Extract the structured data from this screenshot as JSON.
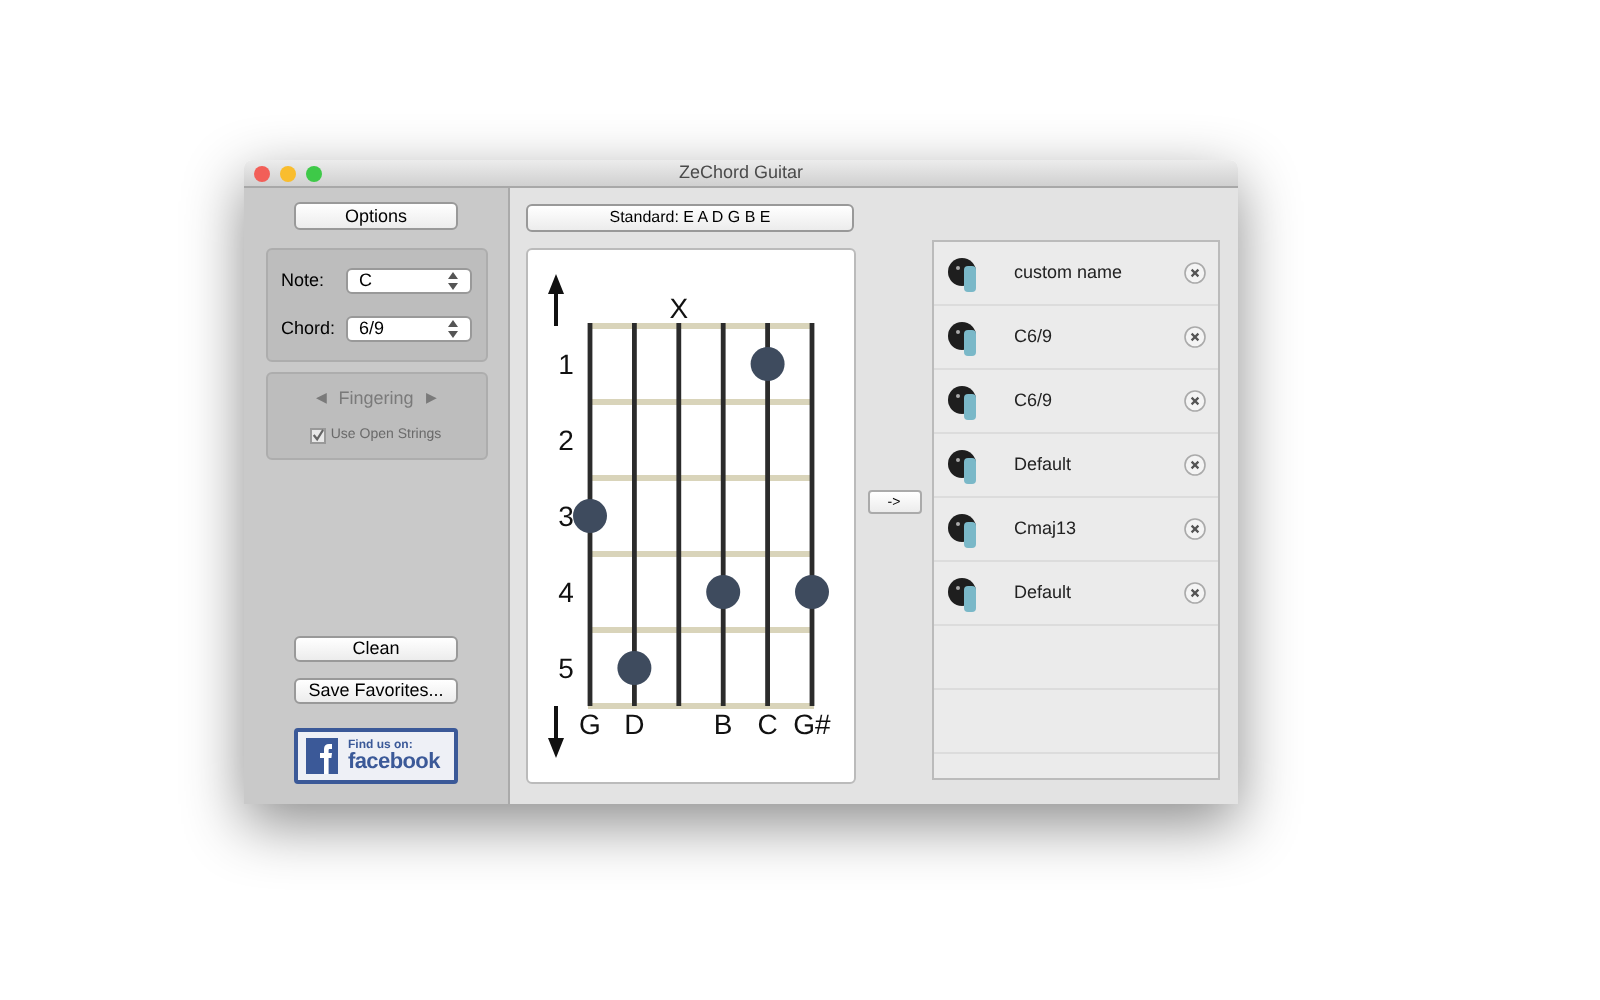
{
  "window": {
    "title": "ZeChord Guitar"
  },
  "sidebar": {
    "options_button": "Options",
    "note": {
      "label": "Note:",
      "value": "C"
    },
    "chord": {
      "label": "Chord:",
      "value": "6/9"
    },
    "fingering": {
      "prev": "◀",
      "label": "Fingering",
      "next": "▶",
      "disabled": true
    },
    "use_open_strings": {
      "label": "Use Open Strings",
      "checked": true,
      "disabled": true
    },
    "clean_button": "Clean",
    "save_button": "Save Favorites...",
    "facebook": {
      "line1": "Find us on:",
      "line2": "facebook"
    }
  },
  "tuning_button": "Standard: E A D G B E",
  "diagram": {
    "frets": [
      {
        "label": "1",
        "pressed": [
          false,
          false,
          false,
          false,
          true,
          false
        ]
      },
      {
        "label": "2",
        "pressed": [
          false,
          false,
          false,
          false,
          false,
          false
        ]
      },
      {
        "label": "3",
        "pressed": [
          true,
          false,
          false,
          false,
          false,
          false
        ]
      },
      {
        "label": "4",
        "pressed": [
          false,
          false,
          false,
          true,
          false,
          true
        ]
      },
      {
        "label": "5",
        "pressed": [
          false,
          true,
          false,
          false,
          false,
          false
        ]
      }
    ],
    "muted_mark": "X",
    "strings": [
      {
        "label": "G",
        "muted": false
      },
      {
        "label": "D",
        "muted": false
      },
      {
        "muted": true
      },
      {
        "label": "B",
        "muted": false
      },
      {
        "label": "C",
        "muted": false
      },
      {
        "label": "G#",
        "muted": false
      }
    ]
  },
  "add_button": "->",
  "favorites": [
    {
      "name": "custom name"
    },
    {
      "name": "C6/9"
    },
    {
      "name": "C6/9"
    },
    {
      "name": "Default"
    },
    {
      "name": "Cmaj13"
    },
    {
      "name": "Default"
    }
  ]
}
